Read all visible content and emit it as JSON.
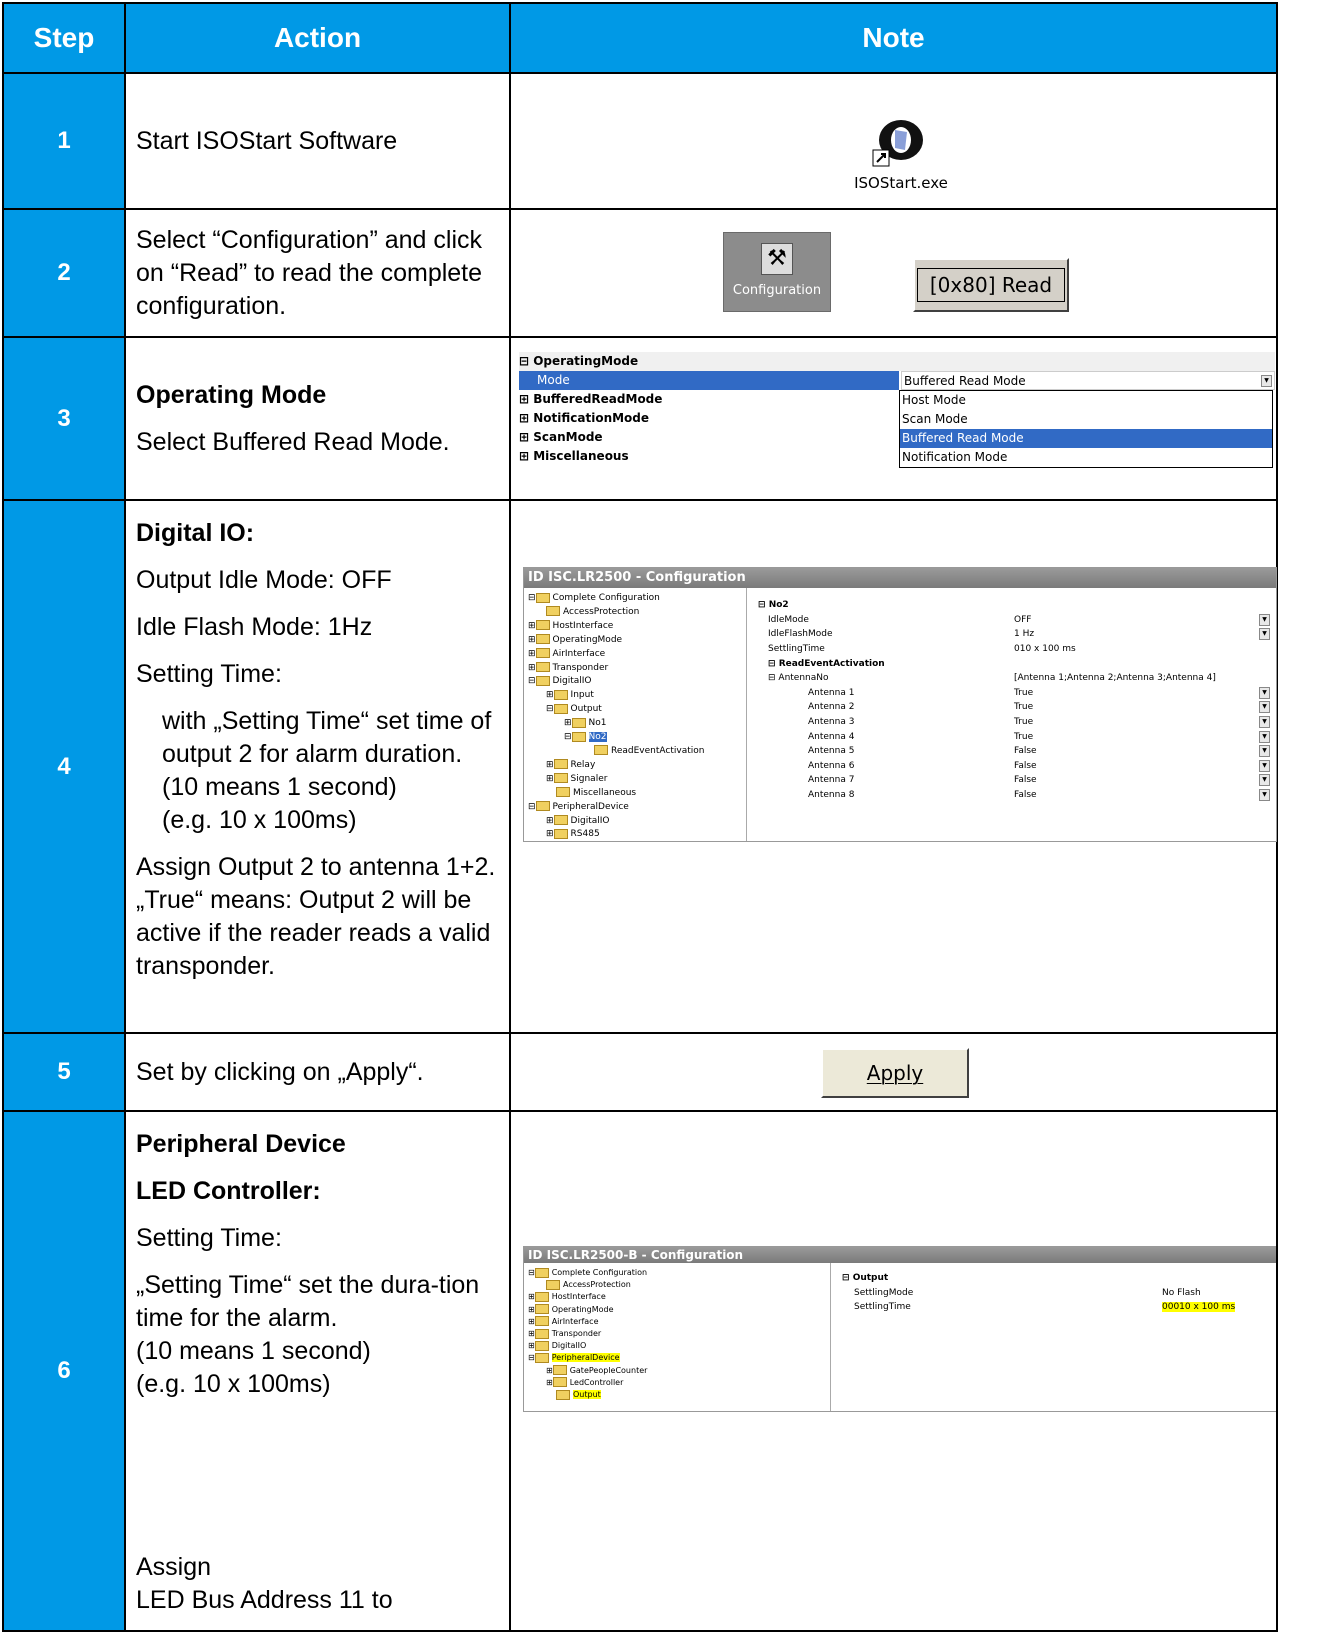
{
  "header": {
    "step": "Step",
    "action": "Action",
    "note": "Note"
  },
  "rows": [
    {
      "step": "1",
      "action": "Start ISOStart Software",
      "note": {
        "icon_label": "ISOStart.exe"
      }
    },
    {
      "step": "2",
      "action": "Select “Configuration” and click on “Read” to read the complete configuration.",
      "note": {
        "config_button": "Configuration",
        "read_button": "[0x80] Read"
      }
    },
    {
      "step": "3",
      "action_title": "Operating Mode",
      "action": "Select Buffered Read Mode.",
      "note": {
        "group": "OperatingMode",
        "mode_label": "Mode",
        "mode_value": "Buffered Read Mode",
        "sub_items": [
          "BufferedReadMode",
          "NotificationMode",
          "ScanMode",
          "Miscellaneous"
        ],
        "options": [
          "Host Mode",
          "Scan Mode",
          "Buffered Read Mode",
          "Notification Mode"
        ],
        "selected_option": "Buffered Read Mode"
      }
    },
    {
      "step": "4",
      "action_title": "Digital IO:",
      "lines": [
        "Output Idle Mode: OFF",
        "Idle Flash Mode: 1Hz",
        "Setting Time:"
      ],
      "indent_text": [
        "with „Setting Time“ set time of output 2 for alarm duration.",
        "(10 means 1 second)",
        "(e.g.  10 x 100ms)"
      ],
      "assign_text": "Assign Output 2 to antenna 1+2. „True“ means: Output 2 will be active if the reader reads a valid transponder.",
      "note": {
        "window_title": "ID ISC.LR2500 - Configuration",
        "tree": [
          "Complete Configuration",
          "AccessProtection",
          "HostInterface",
          "OperatingMode",
          "AirInterface",
          "Transponder",
          "DigitalIO",
          "Input",
          "Output",
          "No1",
          "No2",
          "ReadEventActivation",
          "Relay",
          "Signaler",
          "Miscellaneous",
          "PeripheralDevice",
          "DigitalIO",
          "RS485"
        ],
        "props": [
          [
            "No2",
            ""
          ],
          [
            "IdleMode",
            "OFF"
          ],
          [
            "IdleFlashMode",
            "1 Hz"
          ],
          [
            "SettlingTime",
            "010 x 100 ms"
          ],
          [
            "ReadEventActivation",
            ""
          ],
          [
            "AntennaNo",
            "[Antenna 1;Antenna 2;Antenna 3;Antenna 4]"
          ],
          [
            "Antenna 1",
            "True"
          ],
          [
            "Antenna 2",
            "True"
          ],
          [
            "Antenna 3",
            "True"
          ],
          [
            "Antenna 4",
            "True"
          ],
          [
            "Antenna 5",
            "False"
          ],
          [
            "Antenna 6",
            "False"
          ],
          [
            "Antenna 7",
            "False"
          ],
          [
            "Antenna 8",
            "False"
          ]
        ]
      }
    },
    {
      "step": "5",
      "action": "Set by clicking on „Apply“.",
      "note": {
        "apply_button": "Apply"
      }
    },
    {
      "step": "6",
      "action_title": "Peripheral Device",
      "action_subtitle": "LED Controller:",
      "lines": [
        "Setting Time:",
        "„Setting Time“ set the dura-tion time for the alarm.",
        "(10 means 1 second)",
        "(e.g.  10 x 100ms)"
      ],
      "assign_text": "Assign",
      "assign_text2": "LED Bus Address 11 to",
      "note": {
        "window_title": "ID ISC.LR2500-B - Configuration",
        "tree": [
          "Complete Configuration",
          "AccessProtection",
          "HostInterface",
          "OperatingMode",
          "AirInterface",
          "Transponder",
          "DigitalIO",
          "PeripheralDevice",
          "GatePeopleCounter",
          "LedController",
          "Output"
        ],
        "props": [
          [
            "Output",
            ""
          ],
          [
            "SettlingMode",
            "No Flash"
          ],
          [
            "SettlingTime",
            "00010 x 100 ms"
          ]
        ]
      }
    }
  ]
}
